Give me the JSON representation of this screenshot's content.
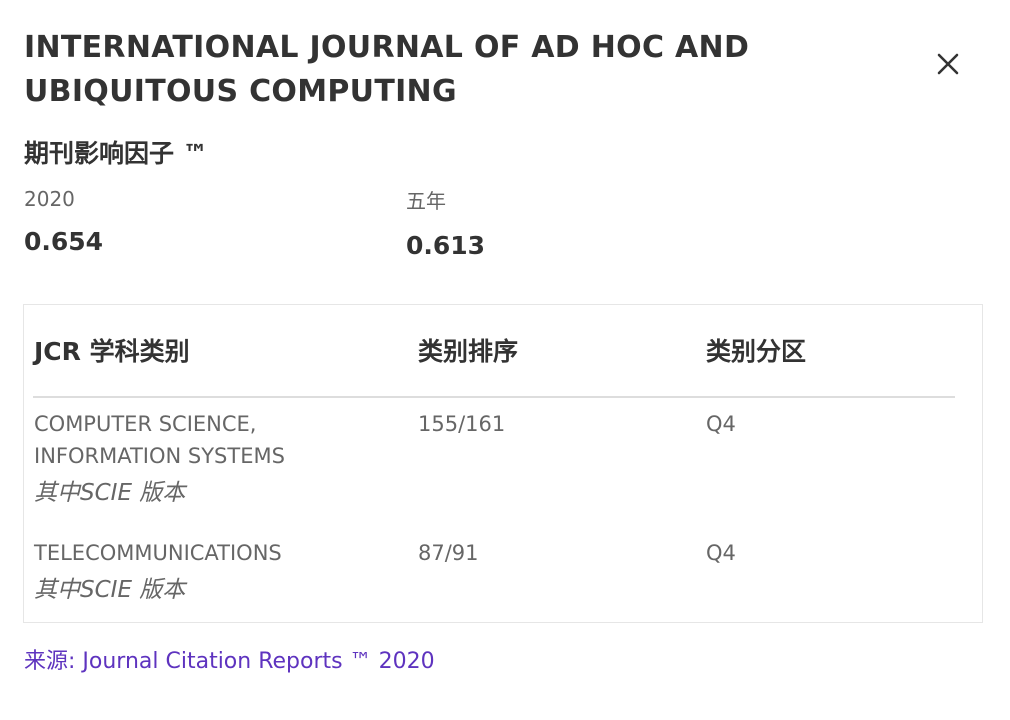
{
  "journal": {
    "title": "INTERNATIONAL JOURNAL OF AD HOC AND UBIQUITOUS COMPUTING"
  },
  "impact_factor": {
    "heading": "期刊影响因子 ™",
    "year_label": "2020",
    "year_value": "0.654",
    "five_year_label": "五年",
    "five_year_value": "0.613"
  },
  "jcr_table": {
    "headers": [
      "JCR 学科类别",
      "类别排序",
      "类别分区"
    ],
    "rows": [
      {
        "category": "COMPUTER SCIENCE, INFORMATION SYSTEMS",
        "edition": "其中SCIE 版本",
        "rank": "155/161",
        "quartile": "Q4"
      },
      {
        "category": "TELECOMMUNICATIONS",
        "edition": "其中SCIE 版本",
        "rank": "87/91",
        "quartile": "Q4"
      }
    ]
  },
  "source": {
    "text": "来源: Journal Citation Reports ™ 2020",
    "color": "#5e33bf"
  },
  "icons": {
    "close": "close-icon"
  }
}
